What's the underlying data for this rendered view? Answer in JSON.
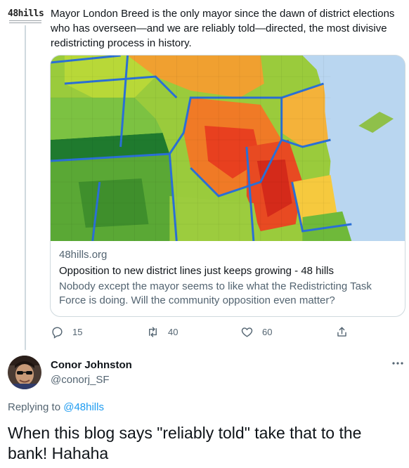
{
  "source": {
    "logo_text": "48hills"
  },
  "tweet": {
    "text": "Mayor London Breed is the only mayor since the dawn of district elections who has overseen—and we are reliably told—directed, the most divisive redistricting process in history."
  },
  "card": {
    "domain": "48hills.org",
    "title": "Opposition to new district lines just keeps growing - 48 hills",
    "description": "Nobody except the mayor seems to like what the Redistricting Task Force is doing. Will the community opposition even matter?"
  },
  "actions": {
    "reply_count": "15",
    "retweet_count": "40",
    "like_count": "60"
  },
  "reply": {
    "name": "Conor Johnston",
    "handle": "@conorj_SF",
    "replying_prefix": "Replying to ",
    "replying_to": "@48hills",
    "text": "When this blog says \"reliably told\" take that to the bank!  Hahaha"
  },
  "colors": {
    "link": "#1d9bf0",
    "secondary_text": "#536471",
    "border": "#cfd9de",
    "map_water": "#b9d6f0",
    "district_line": "#2a6fd6"
  },
  "icons": [
    "reply-icon",
    "retweet-icon",
    "like-icon",
    "share-icon",
    "more-icon"
  ]
}
